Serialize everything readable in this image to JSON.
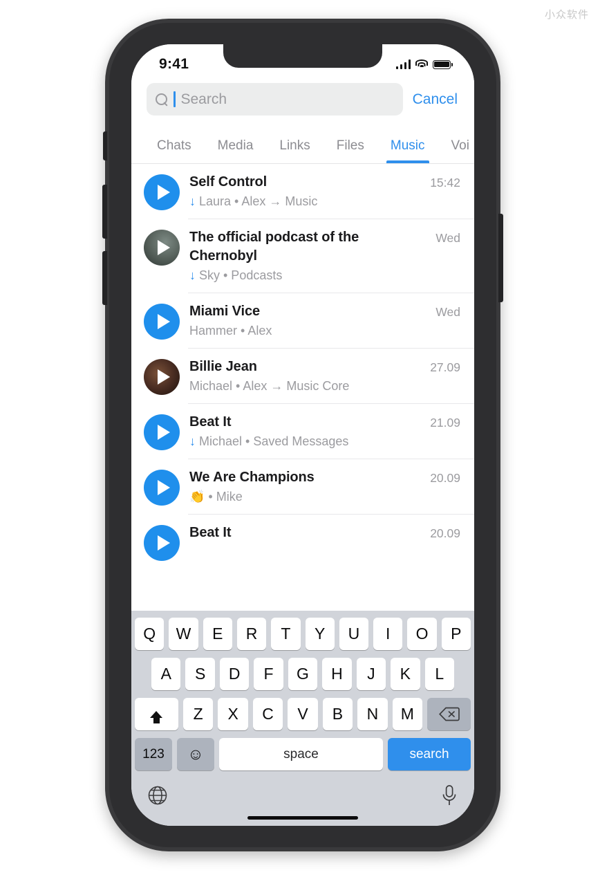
{
  "watermark": "小众软件",
  "status_bar": {
    "time": "9:41",
    "signal_icon": "cellular-signal-icon",
    "wifi_icon": "wifi-icon",
    "battery_icon": "battery-icon"
  },
  "search": {
    "placeholder": "Search",
    "value": "",
    "cancel_label": "Cancel",
    "icon": "search-icon",
    "accent_color": "#2f8fec"
  },
  "tabs": [
    {
      "label": "Chats",
      "active": false
    },
    {
      "label": "Media",
      "active": false
    },
    {
      "label": "Links",
      "active": false
    },
    {
      "label": "Files",
      "active": false
    },
    {
      "label": "Music",
      "active": true
    },
    {
      "label": "Voi",
      "active": false
    }
  ],
  "list": [
    {
      "title": "Self Control",
      "downloaded": true,
      "subtitle": "Laura • Alex → Music",
      "time": "15:42",
      "thumb": "play-button",
      "thumb_color": "#1f8fec"
    },
    {
      "title": "The official podcast of the Chernobyl",
      "downloaded": true,
      "subtitle": "Sky • Podcasts",
      "time": "Wed",
      "thumb": "album-art",
      "thumb_color": "#6b7671"
    },
    {
      "title": "Miami Vice",
      "downloaded": false,
      "subtitle": "Hammer • Alex",
      "time": "Wed",
      "thumb": "play-button",
      "thumb_color": "#1f8fec"
    },
    {
      "title": "Billie Jean",
      "downloaded": false,
      "subtitle": "Michael • Alex → Music Core",
      "time": "27.09",
      "thumb": "album-art",
      "thumb_color": "#4a2d22"
    },
    {
      "title": "Beat It",
      "downloaded": true,
      "subtitle": "Michael • Saved Messages",
      "time": "21.09",
      "thumb": "play-button",
      "thumb_color": "#1f8fec"
    },
    {
      "title": "We Are Champions",
      "downloaded": false,
      "subtitle": "👏 • Mike",
      "time": "20.09",
      "thumb": "play-button",
      "thumb_color": "#1f8fec"
    },
    {
      "title": "Beat It",
      "downloaded": false,
      "subtitle": "",
      "time": "20.09",
      "thumb": "play-button",
      "thumb_color": "#1f8fec"
    }
  ],
  "keyboard": {
    "row1": [
      "Q",
      "W",
      "E",
      "R",
      "T",
      "Y",
      "U",
      "I",
      "O",
      "P"
    ],
    "row2": [
      "A",
      "S",
      "D",
      "F",
      "G",
      "H",
      "J",
      "K",
      "L"
    ],
    "row3": [
      "Z",
      "X",
      "C",
      "V",
      "B",
      "N",
      "M"
    ],
    "shift_icon": "shift-icon",
    "backspace_icon": "backspace-icon",
    "numeric_label": "123",
    "emoji_icon": "emoji-icon",
    "space_label": "space",
    "return_label": "search",
    "globe_icon": "globe-icon",
    "mic_icon": "microphone-icon",
    "return_color": "#2f8fec"
  }
}
